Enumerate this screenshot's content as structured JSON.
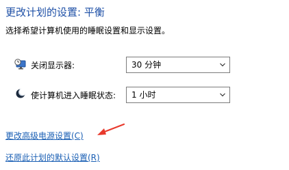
{
  "header": {
    "title": "更改计划的设置: 平衡",
    "subtitle": "选择希望计算机使用的睡眠设置和显示设置。"
  },
  "settings": [
    {
      "icon": "monitor-clock-icon",
      "label": "关闭显示器:",
      "value": "30 分钟"
    },
    {
      "icon": "moon-sleep-icon",
      "label": "使计算机进入睡眠状态:",
      "value": "1 小时"
    }
  ],
  "links": {
    "advanced": "更改高级电源设置(C)",
    "restore": "还原此计划的默认设置(R)"
  },
  "annotation": {
    "arrow_color": "#e8392c"
  }
}
